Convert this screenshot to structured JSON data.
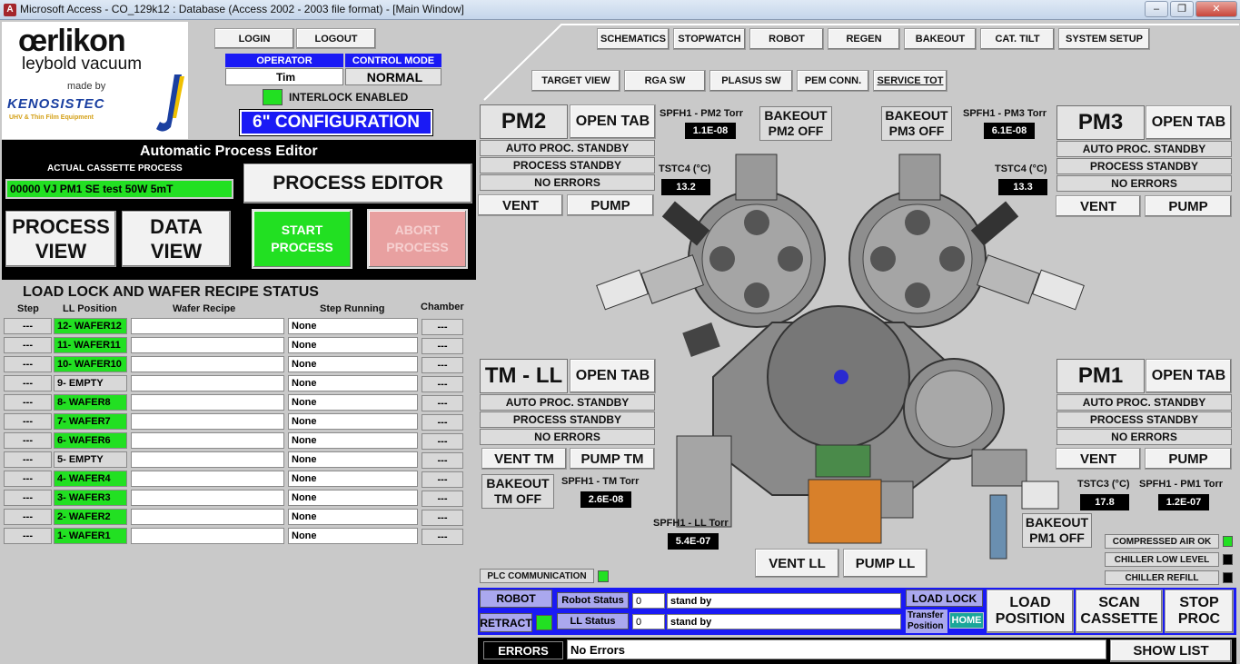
{
  "window": {
    "title": "Microsoft Access - CO_129k12 : Database (Access 2002 - 2003 file format) - [Main Window]",
    "icon_name": "access-app-icon"
  },
  "logo": {
    "line1": "œrlikon",
    "line2": "leybold vacuum",
    "line3": "made by",
    "line4": "KENOSISTEC",
    "line5": "UHV & Thin Film Equipment"
  },
  "session": {
    "login": "LOGIN",
    "logout": "LOGOUT",
    "operator_label": "OPERATOR",
    "operator_value": "Tim",
    "control_mode_label": "CONTROL MODE",
    "control_mode_value": "NORMAL",
    "interlock": "INTERLOCK ENABLED",
    "configuration": "6\" CONFIGURATION"
  },
  "nav_top": [
    "SCHEMATICS",
    "STOPWATCH",
    "ROBOT",
    "REGEN",
    "BAKEOUT",
    "CAT. TILT",
    "SYSTEM SETUP"
  ],
  "nav_bottom": [
    "TARGET VIEW",
    "RGA SW",
    "PLASUS SW",
    "PEM CONN.",
    "SERVICE TOT"
  ],
  "editor": {
    "title": "Automatic Process Editor",
    "actual_label": "ACTUAL CASSETTE PROCESS",
    "actual_value": "00000 VJ PM1 SE test 50W 5mT",
    "process_editor": "PROCESS EDITOR",
    "process_view_1": "PROCESS",
    "process_view_2": "VIEW",
    "data_view_1": "DATA",
    "data_view_2": "VIEW",
    "start_1": "START",
    "start_2": "PROCESS",
    "abort_1": "ABORT",
    "abort_2": "PROCESS"
  },
  "loadlock_table": {
    "title": "LOAD LOCK  AND WAFER RECIPE STATUS",
    "headers": [
      "Step",
      "LL Position",
      "Wafer Recipe",
      "Step Running",
      "Chamber"
    ],
    "rows": [
      {
        "step": "---",
        "pos": "12- WAFER12",
        "recipe": "",
        "running": "None",
        "chamber": "---",
        "green": true
      },
      {
        "step": "---",
        "pos": "11- WAFER11",
        "recipe": "",
        "running": "None",
        "chamber": "---",
        "green": true
      },
      {
        "step": "---",
        "pos": "10- WAFER10",
        "recipe": "",
        "running": "None",
        "chamber": "---",
        "green": true
      },
      {
        "step": "---",
        "pos": "9- EMPTY",
        "recipe": "",
        "running": "None",
        "chamber": "---",
        "green": false
      },
      {
        "step": "---",
        "pos": "8- WAFER8",
        "recipe": "",
        "running": "None",
        "chamber": "---",
        "green": true
      },
      {
        "step": "---",
        "pos": "7- WAFER7",
        "recipe": "",
        "running": "None",
        "chamber": "---",
        "green": true
      },
      {
        "step": "---",
        "pos": "6- WAFER6",
        "recipe": "",
        "running": "None",
        "chamber": "---",
        "green": true
      },
      {
        "step": "---",
        "pos": "5- EMPTY",
        "recipe": "",
        "running": "None",
        "chamber": "---",
        "green": false
      },
      {
        "step": "---",
        "pos": "4- WAFER4",
        "recipe": "",
        "running": "None",
        "chamber": "---",
        "green": true
      },
      {
        "step": "---",
        "pos": "3- WAFER3",
        "recipe": "",
        "running": "None",
        "chamber": "---",
        "green": true
      },
      {
        "step": "---",
        "pos": "2- WAFER2",
        "recipe": "",
        "running": "None",
        "chamber": "---",
        "green": true
      },
      {
        "step": "---",
        "pos": "1- WAFER1",
        "recipe": "",
        "running": "None",
        "chamber": "---",
        "green": true
      }
    ]
  },
  "pm2": {
    "name": "PM2",
    "open_tab": "OPEN TAB",
    "s1": "AUTO PROC. STANDBY",
    "s2": "PROCESS STANDBY",
    "s3": "NO ERRORS",
    "vent": "VENT",
    "pump": "PUMP",
    "spfh_label": "SPFH1 - PM2 Torr",
    "spfh_value": "1.1E-08",
    "tstc_label": "TSTC4 (°C)",
    "tstc_value": "13.2",
    "bakeout_1": "BAKEOUT",
    "bakeout_2": "PM2 OFF"
  },
  "pm3": {
    "name": "PM3",
    "open_tab": "OPEN TAB",
    "s1": "AUTO PROC. STANDBY",
    "s2": "PROCESS STANDBY",
    "s3": "NO ERRORS",
    "vent": "VENT",
    "pump": "PUMP",
    "spfh_label": "SPFH1 - PM3 Torr",
    "spfh_value": "6.1E-08",
    "tstc_label": "TSTC4 (°C)",
    "tstc_value": "13.3",
    "bakeout_1": "BAKEOUT",
    "bakeout_2": "PM3 OFF"
  },
  "tmll": {
    "name": "TM - LL",
    "open_tab": "OPEN TAB",
    "s1": "AUTO PROC. STANDBY",
    "s2": "PROCESS STANDBY",
    "s3": "NO ERRORS",
    "vent": "VENT TM",
    "pump": "PUMP TM",
    "bakeout_1": "BAKEOUT",
    "bakeout_2": "TM OFF",
    "spfh_label": "SPFH1 - TM Torr",
    "spfh_value": "2.6E-08",
    "ll_label": "SPFH1 - LL Torr",
    "ll_value": "5.4E-07",
    "vent_ll": "VENT LL",
    "pump_ll": "PUMP LL"
  },
  "pm1": {
    "name": "PM1",
    "open_tab": "OPEN TAB",
    "s1": "AUTO PROC. STANDBY",
    "s2": "PROCESS STANDBY",
    "s3": "NO ERRORS",
    "vent": "VENT",
    "pump": "PUMP",
    "tstc_label": "TSTC3 (°C)",
    "tstc_value": "17.8",
    "spfh_label": "SPFH1 - PM1 Torr",
    "spfh_value": "1.2E-07",
    "bakeout_1": "BAKEOUT",
    "bakeout_2": "PM1 OFF"
  },
  "utilities": {
    "compressed_air": "COMPRESSED AIR OK",
    "chiller_low": "CHILLER LOW LEVEL",
    "chiller_refill": "CHILLER REFILL",
    "plc": "PLC COMMUNICATION"
  },
  "robot_bar": {
    "robot": "ROBOT",
    "retract": "RETRACT",
    "robot_status_label": "Robot Status",
    "robot_status_num": "0",
    "robot_status_text": "stand by",
    "ll_status_label": "LL Status",
    "ll_status_num": "0",
    "ll_status_text": "stand by",
    "load_lock": "LOAD LOCK",
    "transfer_position_1": "Transfer",
    "transfer_position_2": "Position",
    "home": "HOME",
    "load_position_1": "LOAD",
    "load_position_2": "POSITION",
    "scan_cassette_1": "SCAN",
    "scan_cassette_2": "CASSETTE",
    "stop_proc_1": "STOP",
    "stop_proc_2": "PROC"
  },
  "errors": {
    "label": "ERRORS",
    "value": "No Errors",
    "show_list": "SHOW LIST"
  },
  "colors": {
    "green": "#22e022",
    "blue": "#1a1af5",
    "lavender": "#aaa8ee",
    "abort_pink": "#e8a0a0"
  }
}
